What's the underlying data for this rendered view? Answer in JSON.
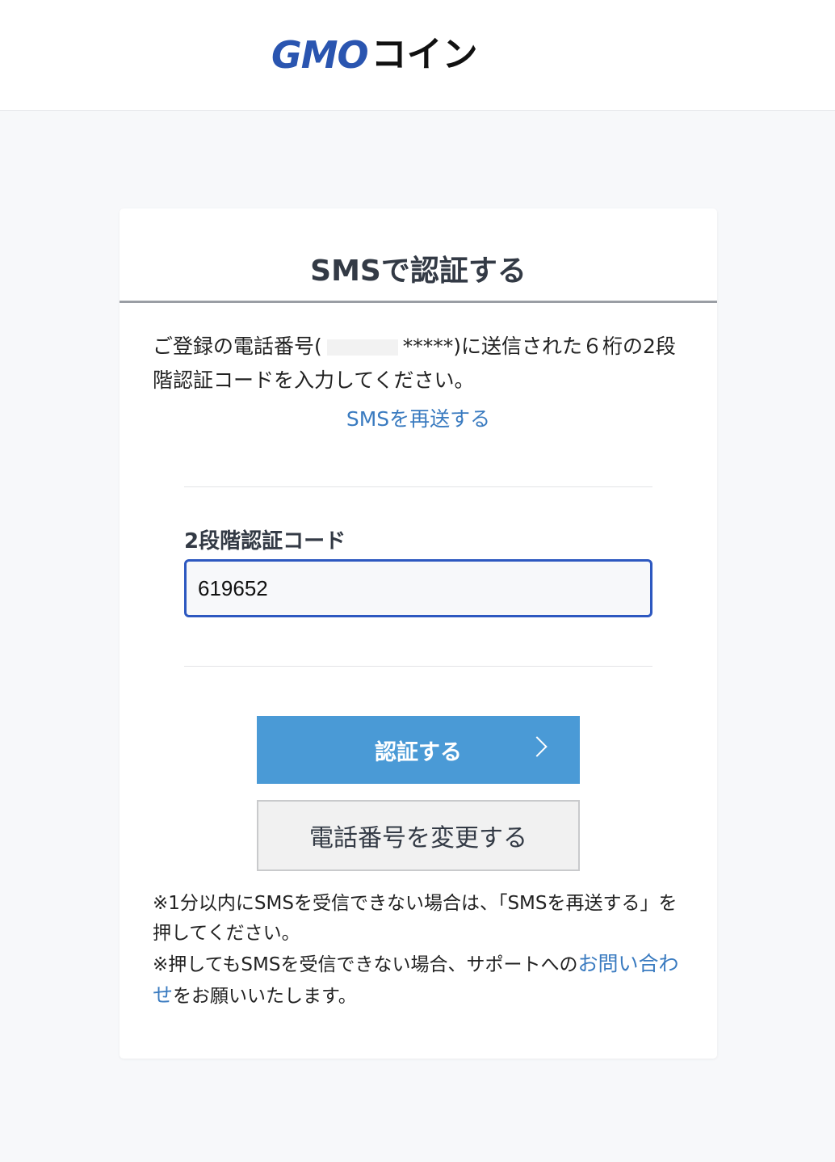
{
  "header": {
    "logo_text_gmo": "GMO",
    "logo_text_coin": "コイン"
  },
  "card": {
    "title": "SMSで認証する",
    "intro_before": "ご登録の電話番号(",
    "intro_masked": "*****)に送信された６桁の2段階認証コードを入力してください。",
    "resend_link": "SMSを再送する",
    "code_label": "2段階認証コード",
    "code_value": "619652",
    "submit_button": "認証する",
    "change_phone_button": "電話番号を変更する",
    "note_1": "※1分以内にSMSを受信できない場合は、「SMSを再送する」を押してください。",
    "note_2_before": "※押してもSMSを受信できない場合、サポートへの",
    "note_2_link": "お問い合わせ",
    "note_2_after": "をお願いいたします。"
  },
  "colors": {
    "brand_blue": "#2a55b0",
    "brand_red": "#d71920",
    "link_blue": "#3a7bc0",
    "primary_button": "#4a9ad6",
    "input_border": "#2d58c0"
  }
}
